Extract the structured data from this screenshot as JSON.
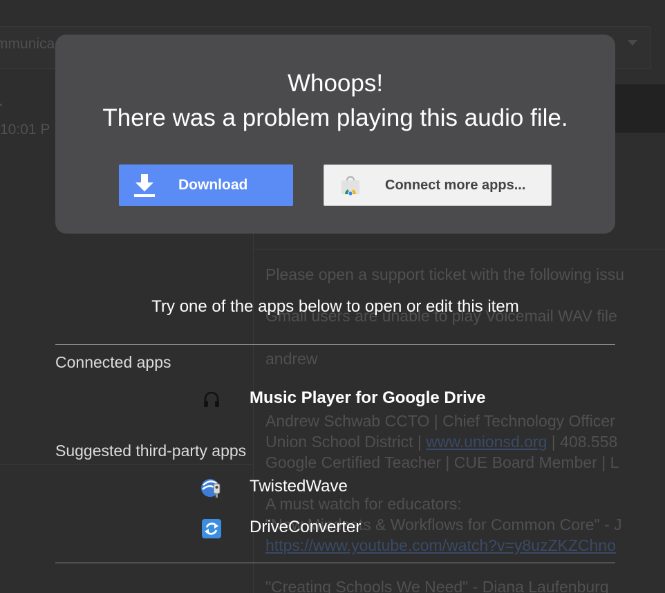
{
  "background": {
    "subject": "mmunica",
    "time": "10:01 P",
    "lines": [
      "Please open a support ticket with the following issu",
      "Gmail users are unable to play Voicemail WAV file",
      "andrew",
      "Andrew Schwab CCTO | Chief Technology Officer",
      "Union School District |",
      "www.unionsd.org",
      "| 408.558",
      "Google Certified Teacher | CUE Board Member | L",
      "A must watch for educators:",
      "\"New Mindsets & Workflows for Common Core\" - J",
      "https://www.youtube.com/watch?v=y8uzZKZChno",
      "\"Creating Schools We Need\" - Diana Laufenburg"
    ]
  },
  "dialog": {
    "title_line1": "Whoops!",
    "title_line2": "There was a problem playing this audio file.",
    "download_label": "Download",
    "connect_label": "Connect more apps..."
  },
  "apps": {
    "prompt": "Try one of the apps below to open or edit this item",
    "connected_title": "Connected apps",
    "connected": [
      {
        "name": "Music Player for Google Drive",
        "icon": "headphones-icon"
      }
    ],
    "suggested_title": "Suggested third-party apps",
    "suggested": [
      {
        "name": "TwistedWave",
        "icon": "twistedwave-icon"
      },
      {
        "name": "DriveConverter",
        "icon": "driveconverter-icon"
      }
    ]
  },
  "colors": {
    "overlay_bg": "#2e2e2e",
    "dialog_bg": "#4b4a4d",
    "download_btn": "#5b8cf6",
    "connect_btn": "#f1f1f1"
  }
}
